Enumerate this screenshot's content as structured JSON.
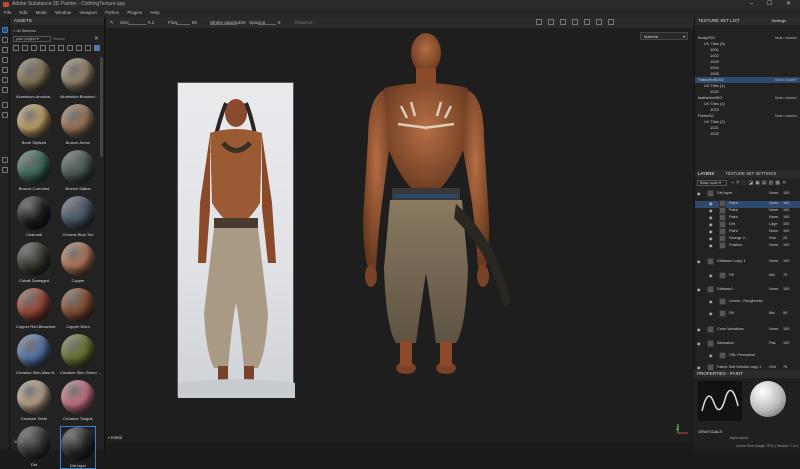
{
  "window": {
    "title": "Adobe Substance 3D Painter - ClothingTexture.spp",
    "controls": "–  ☐  ✕"
  },
  "menu": [
    "File",
    "Edit",
    "Mode",
    "Window",
    "Viewport",
    "Python",
    "Plugins",
    "Help"
  ],
  "toolbar": {
    "size_label": "Size",
    "size_value": "0.2",
    "flow_label": "Flow",
    "flow_value": "50",
    "stroke_opacity_label": "Stroke opacity",
    "stroke_opacity_value": "100",
    "spacing_label": "Spacing",
    "spacing_value": "8",
    "distance_label": "Distance"
  },
  "viewport": {
    "mode_dropdown": "Material",
    "bottom_label": "metal"
  },
  "assets": {
    "title": "ASSETS",
    "breadcrumb": "All libraries",
    "filter": "your project",
    "search_placeholder": "Search",
    "materials": [
      {
        "name": "Aluminium Anodize...",
        "color": "#8a7a5a"
      },
      {
        "name": "Aluminium Brushed...",
        "color": "#9a8a70"
      },
      {
        "name": "Bone Stylized",
        "color": "#c9a86a"
      },
      {
        "name": "Bronze Armor",
        "color": "#a0785a"
      },
      {
        "name": "Bronze Corroded",
        "color": "#3d6e5a"
      },
      {
        "name": "Bronze Statue",
        "color": "#4a5a5a"
      },
      {
        "name": "Charcoal",
        "color": "#202020"
      },
      {
        "name": "Chrome Blue Tint",
        "color": "#4a5a6a"
      },
      {
        "name": "Cobalt Damaged",
        "color": "#3a3a30"
      },
      {
        "name": "Copper",
        "color": "#b87a5a"
      },
      {
        "name": "Copper Red Bleached",
        "color": "#a04a3a"
      },
      {
        "name": "Copper Worn",
        "color": "#8a5030"
      },
      {
        "name": "Creature Skin Alien B...",
        "color": "#5a7ab0"
      },
      {
        "name": "Creature Skin Green ...",
        "color": "#6a7a30"
      },
      {
        "name": "Creature Teeth",
        "color": "#c0a890"
      },
      {
        "name": "Creature Tongue",
        "color": "#d07888"
      },
      {
        "name": "Dirt",
        "color": "#3a3a38"
      },
      {
        "name": "Dirt layer",
        "color": "#2a2a28"
      }
    ]
  },
  "texture_set_list": {
    "title": "TEXTURE SET LIST",
    "settings": "Settings",
    "rows": [
      {
        "label": "Body2SG",
        "right": "Main shader",
        "indent": 0,
        "sel": false
      },
      {
        "label": "UV Tiles (5)",
        "right": "",
        "indent": 1,
        "sel": false
      },
      {
        "label": "1001",
        "right": "",
        "indent": 2,
        "sel": false
      },
      {
        "label": "1002",
        "right": "",
        "indent": 2,
        "sel": false
      },
      {
        "label": "1003",
        "right": "",
        "indent": 2,
        "sel": false
      },
      {
        "label": "1004",
        "right": "",
        "indent": 2,
        "sel": false
      },
      {
        "label": "1005",
        "right": "",
        "indent": 2,
        "sel": false
      },
      {
        "label": "Fabric9oft1SG",
        "right": "Main shader",
        "indent": 0,
        "sel": true
      },
      {
        "label": "UV Tiles (1)",
        "right": "",
        "indent": 1,
        "sel": false
      },
      {
        "label": "1022",
        "right": "",
        "indent": 2,
        "sel": false
      },
      {
        "label": "leatherbeltSG",
        "right": "Main shader",
        "indent": 0,
        "sel": false
      },
      {
        "label": "UV Tiles (1)",
        "right": "",
        "indent": 1,
        "sel": false
      },
      {
        "label": "1023",
        "right": "",
        "indent": 2,
        "sel": false
      },
      {
        "label": "PantsSG",
        "right": "Main shader",
        "indent": 0,
        "sel": false
      },
      {
        "label": "UV Tiles (2)",
        "right": "",
        "indent": 1,
        "sel": false
      },
      {
        "label": "1021",
        "right": "",
        "indent": 2,
        "sel": false
      },
      {
        "label": "1022",
        "right": "",
        "indent": 2,
        "sel": false
      }
    ]
  },
  "layers": {
    "tab1": "LAYERS",
    "tab2": "TEXTURE SET SETTINGS",
    "channel": "Base color",
    "items": [
      {
        "name": "Dirt layer",
        "blend": "Norm",
        "opacity": "100"
      },
      {
        "name": "Paint",
        "blend": "Norm",
        "opacity": "100"
      },
      {
        "name": "Paint",
        "blend": "Norm",
        "opacity": "100"
      },
      {
        "name": "Paint",
        "blend": "Norm",
        "opacity": "100"
      },
      {
        "name": "Dirt",
        "blend": "Ldge",
        "opacity": "100"
      },
      {
        "name": "Paint",
        "blend": "Norm",
        "opacity": "100"
      },
      {
        "name": "Grunge 2...",
        "blend": "Sub",
        "opacity": "25"
      },
      {
        "name": "Position",
        "blend": "Norm",
        "opacity": "100"
      },
      {
        "name": "Dirtbase1 copy 1",
        "blend": "Norm",
        "opacity": "100"
      },
      {
        "name": "Fill",
        "blend": "Mul",
        "opacity": "70"
      },
      {
        "name": "Dirtbase1",
        "blend": "Norm",
        "opacity": "100"
      },
      {
        "name": "Levels - Roughness",
        "blend": "",
        "opacity": ""
      },
      {
        "name": "Fill",
        "blend": "Mul",
        "opacity": "50"
      },
      {
        "name": "Color Variations",
        "blend": "Norm",
        "opacity": "100"
      },
      {
        "name": "Saturation",
        "blend": "Pas",
        "opacity": "100"
      },
      {
        "name": "HSL Perceptive",
        "blend": "",
        "opacity": ""
      },
      {
        "name": "Fabric Soft Wrinkle copy 1",
        "blend": "Ovrl",
        "opacity": "75"
      }
    ]
  },
  "properties": {
    "title": "PROPERTIES - PAINT",
    "grayscale": "GRAYSCALE",
    "alpha": "alpha alpha"
  },
  "status": {
    "text": "Cache Disk Usage: 97% | Version: 7.4.3"
  }
}
